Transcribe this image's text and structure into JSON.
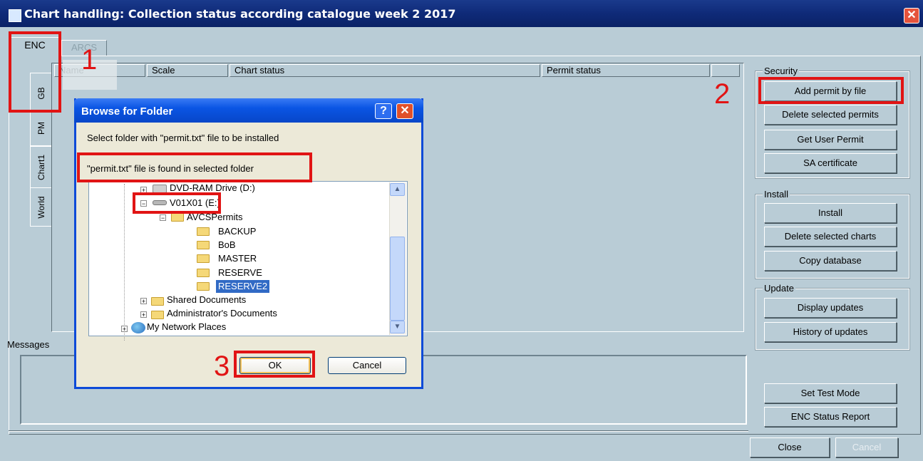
{
  "window": {
    "title": "Chart handling:  Collection status according catalogue week  2  2017",
    "close_glyph": "✕"
  },
  "tabs": [
    {
      "label": "ENC"
    },
    {
      "label": "ARCS"
    }
  ],
  "vertical_tabs": [
    {
      "label": "GB"
    },
    {
      "label": "PM"
    },
    {
      "label": "Chart1"
    },
    {
      "label": "World"
    }
  ],
  "grid": {
    "columns": [
      "Name",
      "Scale",
      "Chart status",
      "Permit status",
      ""
    ]
  },
  "security": {
    "label": "Security",
    "buttons": [
      {
        "label": "Add permit by file"
      },
      {
        "label": "Delete selected permits"
      },
      {
        "label": "Get User Permit"
      },
      {
        "label": "SA certificate"
      }
    ]
  },
  "install": {
    "label": "Install",
    "buttons": [
      {
        "label": "Install"
      },
      {
        "label": "Delete selected charts"
      },
      {
        "label": "Copy database"
      }
    ]
  },
  "update": {
    "label": "Update",
    "buttons": [
      {
        "label": "Display updates"
      },
      {
        "label": "History of updates"
      }
    ]
  },
  "extra_buttons": [
    {
      "label": "Set Test Mode"
    },
    {
      "label": "ENC Status Report"
    }
  ],
  "footer_buttons": {
    "close": "Close",
    "cancel": "Cancel"
  },
  "messages": {
    "label": "Messages"
  },
  "annotations": [
    "1",
    "2",
    "3"
  ],
  "dialog": {
    "title": "Browse for Folder",
    "help_glyph": "?",
    "close_glyph": "✕",
    "instruction": "Select folder with \"permit.txt\" file to be installed",
    "status": "\"permit.txt\" file is found in selected folder",
    "tree": [
      {
        "label": "DVD-RAM Drive (D:)",
        "type": "drive",
        "expander": "+"
      },
      {
        "label": "V01X01 (E:)",
        "type": "drive",
        "expander": "−"
      },
      {
        "label": "AVCSPermits",
        "type": "folder",
        "expander": "−"
      },
      {
        "label": "BACKUP",
        "type": "folder"
      },
      {
        "label": "BoB",
        "type": "folder"
      },
      {
        "label": "MASTER",
        "type": "folder"
      },
      {
        "label": "RESERVE",
        "type": "folder"
      },
      {
        "label": "RESERVE2",
        "type": "folder",
        "selected": true
      },
      {
        "label": "Shared Documents",
        "type": "folder",
        "expander": "+"
      },
      {
        "label": "Administrator's Documents",
        "type": "folder",
        "expander": "+"
      },
      {
        "label": "My Network Places",
        "type": "network",
        "expander": "+"
      }
    ],
    "ok": "OK",
    "cancel": "Cancel",
    "scroll_up": "▲",
    "scroll_down": "▼"
  },
  "colors": {
    "background": "#b9ccd6",
    "annotation": "#e11414",
    "title_bar": "#0f2a78",
    "selection": "#316ac5"
  }
}
